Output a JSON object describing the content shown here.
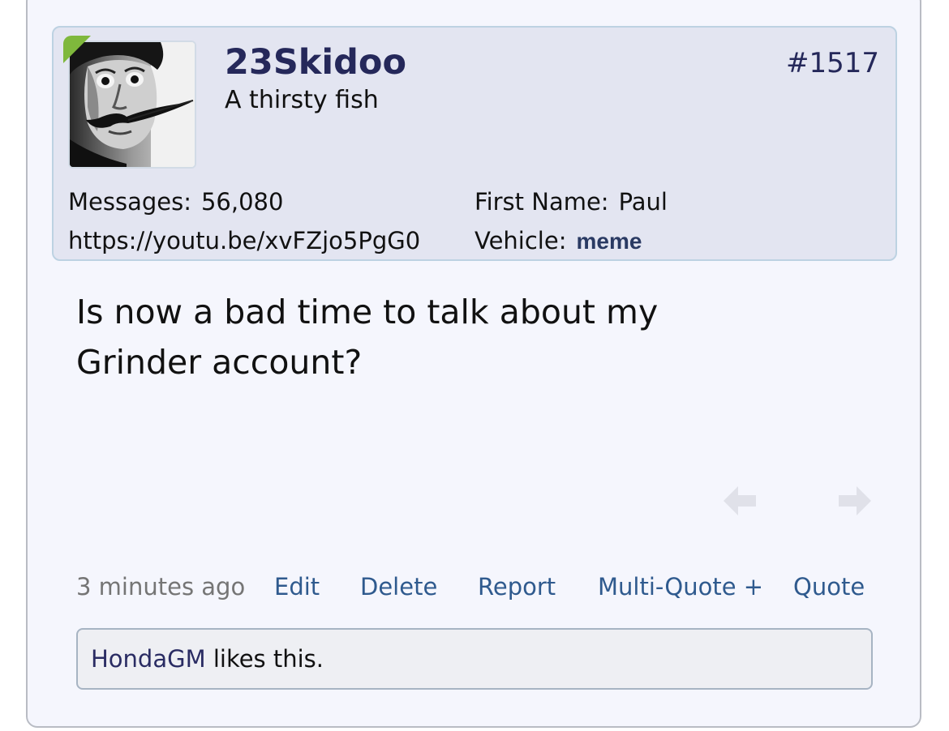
{
  "post": {
    "username": "23Skidoo",
    "user_title": "A thirsty fish",
    "post_number": "#1517",
    "avatar_icon": "profile-photo",
    "online_indicator_color": "#7fb83c",
    "info": {
      "messages_label": "Messages:",
      "messages_value": "56,080",
      "website": "https://youtu.be/xvFZjo5PgG0",
      "first_name_label": "First Name:",
      "first_name_value": "Paul",
      "vehicle_label": "Vehicle:",
      "vehicle_value": "meme"
    },
    "message_line1": "Is now a bad time to talk about my",
    "message_line2": "Grinder account?",
    "timestamp": "3 minutes ago",
    "actions": {
      "edit": "Edit",
      "delete": "Delete",
      "report": "Report",
      "multi_quote": "Multi-Quote +",
      "quote": "Quote"
    },
    "likes": {
      "liker": "HondaGM",
      "suffix": " likes this."
    },
    "nav": {
      "prev_icon": "arrow-left-icon",
      "next_icon": "arrow-right-icon"
    }
  },
  "colors": {
    "username": "#25285a",
    "link": "#2f5a8e",
    "card_bg": "#f5f6fd",
    "panel_bg": "#e3e5f1"
  }
}
